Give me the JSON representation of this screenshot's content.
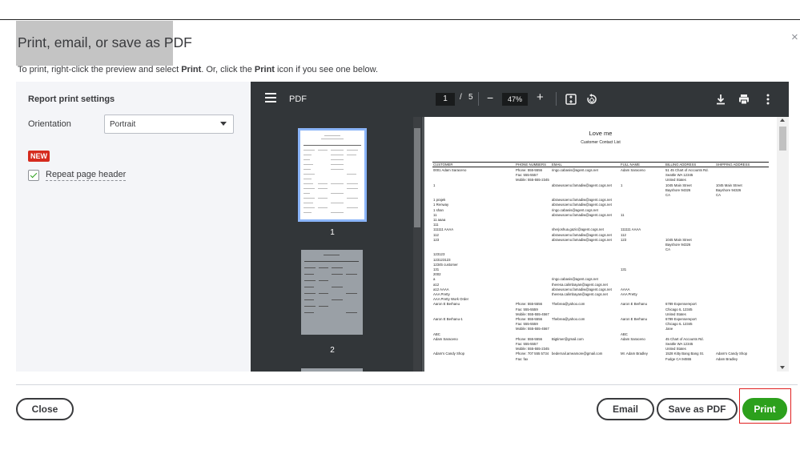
{
  "dialog": {
    "title": "Print, email, or save as PDF",
    "instructions": {
      "part1": "To print, right-click the preview and select ",
      "bold1": "Print",
      "part2": ". Or, click the ",
      "bold2": "Print",
      "part3": " icon if you see one below."
    },
    "close_icon": "×"
  },
  "settings": {
    "title": "Report print settings",
    "orientation_label": "Orientation",
    "orientation_value": "Portrait",
    "new_badge": "NEW",
    "repeat_header_label": "Repeat page header",
    "repeat_header_checked": true
  },
  "viewer": {
    "app_title": "PDF",
    "current_page": "1",
    "page_separator": "/",
    "total_pages": "5",
    "zoom": "47%",
    "thumbnails": [
      {
        "page": "1",
        "selected": true
      },
      {
        "page": "2",
        "selected": false
      }
    ],
    "icons": [
      "menu-icon",
      "fit-page-icon",
      "rotate-icon",
      "download-icon",
      "print-icon",
      "more-icon"
    ]
  },
  "report": {
    "title": "Love me",
    "subtitle": "Customer Contact List",
    "columns": [
      "CUSTOMER",
      "PHONE NUMBERS",
      "EMAIL",
      "FULL NAME",
      "BILLING ADDRESS",
      "SHIPPING ADDRESS"
    ],
    "rows": [
      [
        "0001 Adam Saraceno",
        "Phone: 555-5556",
        "ringo.cabasis@agent.cogs.net",
        "Adam Saraceno",
        "51 45 Chart of Accounts Rd.",
        ""
      ],
      [
        "",
        "Fax: 555-5557",
        "",
        "",
        "Seattle WA 12345",
        ""
      ],
      [
        "",
        "Mobile: 555-555-2345",
        "",
        "",
        "United States",
        ""
      ],
      [
        "1",
        "",
        "abraeusoeno.famadiw@agent.cogs.net",
        "1",
        "1045 Main Street",
        "1045 Main Street"
      ],
      [
        "",
        "",
        "",
        "",
        "Bayshore 94326",
        "Bayshore 94326"
      ],
      [
        "",
        "",
        "",
        "",
        "CA",
        "CA"
      ],
      [
        "1 prajek",
        "",
        "abraeusoeno.famadiw@agent.cogs.net",
        "",
        "",
        ""
      ],
      [
        "1 Renway",
        "",
        "abraeusoeno.famadiw@agent.cogs.net",
        "",
        "",
        ""
      ],
      [
        "1 shan",
        "",
        "ringo.cabasis@agent.cogs.net",
        "",
        "",
        ""
      ],
      [
        "11",
        "",
        "abraeusoeno.famadiw@agent.cogs.net",
        "11",
        "",
        ""
      ],
      [
        "11 aaaa",
        "",
        "",
        "",
        "",
        ""
      ],
      [
        "111",
        "",
        "",
        "",
        "",
        ""
      ],
      [
        "111111 AAAA",
        "",
        "sherjoshua.gazic@agent.cogs.net",
        "111111 AAAA",
        "",
        ""
      ],
      [
        "112",
        "",
        "abraeusoeno.famadiw@agent.cogs.net",
        "112",
        "",
        ""
      ],
      [
        "123",
        "",
        "abraeusoeno.famadiw@agent.cogs.net",
        "123",
        "1045 Main Street",
        ""
      ],
      [
        "",
        "",
        "",
        "",
        "Bayshore 94326",
        ""
      ],
      [
        "",
        "",
        "",
        "",
        "CA",
        ""
      ],
      [
        "123123",
        "",
        "",
        "",
        "",
        ""
      ],
      [
        "123123123",
        "",
        "",
        "",
        "",
        ""
      ],
      [
        "12345 customer",
        "",
        "",
        "",
        "",
        ""
      ],
      [
        "131",
        "",
        "",
        "131",
        "",
        ""
      ],
      [
        "2002",
        "",
        "",
        "",
        "",
        ""
      ],
      [
        "a",
        "",
        "ringo.cabasis@agent.cogs.net",
        "",
        "",
        ""
      ],
      [
        "a12",
        "",
        "theresa.calimbayan@agent.cogs.net",
        "",
        "",
        ""
      ],
      [
        "a12 AAAA",
        "",
        "abraeusoeno.famadiw@agent.cogs.net",
        "AAAA",
        "",
        ""
      ],
      [
        "AAA Pretty",
        "",
        "theresa.calimbayan@agent.cogs.net",
        "AAA Pretty",
        "",
        ""
      ],
      [
        "AAA Pretty Work Order",
        "",
        "",
        "",
        "",
        ""
      ],
      [
        "Aaron E Berhanu",
        "Phone: 555-5556",
        "Thebrea@yahoo.com",
        "Aaron E Berhanu",
        "6789 Expensereport",
        ""
      ],
      [
        "",
        "Fax: 555-5559",
        "",
        "",
        "Chicago IL 12345",
        ""
      ],
      [
        "",
        "Mobile: 555-555-4567",
        "",
        "",
        "United States",
        ""
      ],
      [
        "Aaron E Berhanu-1",
        "Phone: 555-5556",
        "Thebrea@yahoo.com",
        "Aaron E Berhanu",
        "6789 Expensereport",
        ""
      ],
      [
        "",
        "Fax: 555-5559",
        "",
        "",
        "Chicago IL 12345",
        ""
      ],
      [
        "",
        "Mobile: 555-555-4567",
        "",
        "",
        "Jane",
        ""
      ],
      [
        "ABC",
        "",
        "",
        "ABC",
        "",
        ""
      ],
      [
        "Adam Saraceno",
        "Phone: 555-5556",
        "Bigtimer@gmail.com",
        "Adam Saraceno",
        "45 Chart of Accounts Rd.",
        ""
      ],
      [
        "",
        "Fax: 555-5557",
        "",
        "",
        "Seattle WA 12345",
        ""
      ],
      [
        "",
        "Mobile: 555-555-2345",
        "",
        "",
        "United States",
        ""
      ],
      [
        "Adam's Candy Shop",
        "Phone: 707 555 5734",
        "bedernail.ameamore@gmail.com",
        "Mr. Adam Bradley",
        "1528 Kitty Bang Bang St.",
        "Adam's Candy Shop"
      ],
      [
        "",
        "Fax: fax",
        "",
        "",
        "Fudge CA 94555",
        "Adam Bradley"
      ]
    ]
  },
  "footer": {
    "close_label": "Close",
    "email_label": "Email",
    "save_pdf_label": "Save as PDF",
    "print_label": "Print"
  },
  "colors": {
    "primary_green": "#2ca01c",
    "viewer_toolbar": "#323639",
    "viewer_bg": "#525659",
    "new_badge": "#d52b1e",
    "highlight_outline": "#e02020"
  }
}
